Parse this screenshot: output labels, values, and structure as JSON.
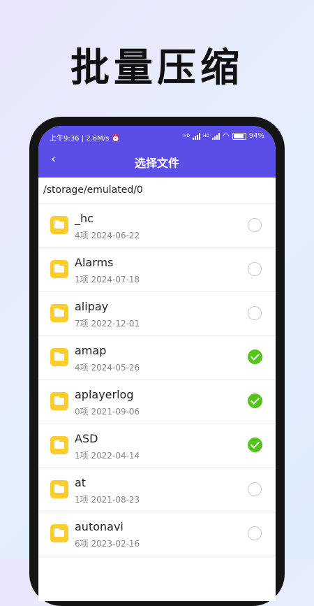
{
  "promo": {
    "title": "批量压缩"
  },
  "status": {
    "time": "上午9:36",
    "speed": "2.6M/s",
    "battery": "94%",
    "net1": "HD",
    "net2": "HD"
  },
  "header": {
    "back_icon": "‹",
    "title": "选择文件"
  },
  "path": "/storage/emulated/0",
  "files": [
    {
      "name": "_hc",
      "meta": "4项  2024-06-22",
      "selected": false
    },
    {
      "name": "Alarms",
      "meta": "1项  2024-07-18",
      "selected": false
    },
    {
      "name": "alipay",
      "meta": "7项  2022-12-01",
      "selected": false
    },
    {
      "name": "amap",
      "meta": "4项  2024-05-26",
      "selected": true
    },
    {
      "name": "aplayerlog",
      "meta": "0项  2021-09-06",
      "selected": true
    },
    {
      "name": "ASD",
      "meta": "1项  2022-04-14",
      "selected": true
    },
    {
      "name": "at",
      "meta": "1项  2021-08-23",
      "selected": false
    },
    {
      "name": "autonavi",
      "meta": "6项  2023-02-16",
      "selected": false
    }
  ],
  "colors": {
    "accent": "#5b4ee8",
    "folder": "#fccd2c",
    "selected": "#52c41a"
  }
}
